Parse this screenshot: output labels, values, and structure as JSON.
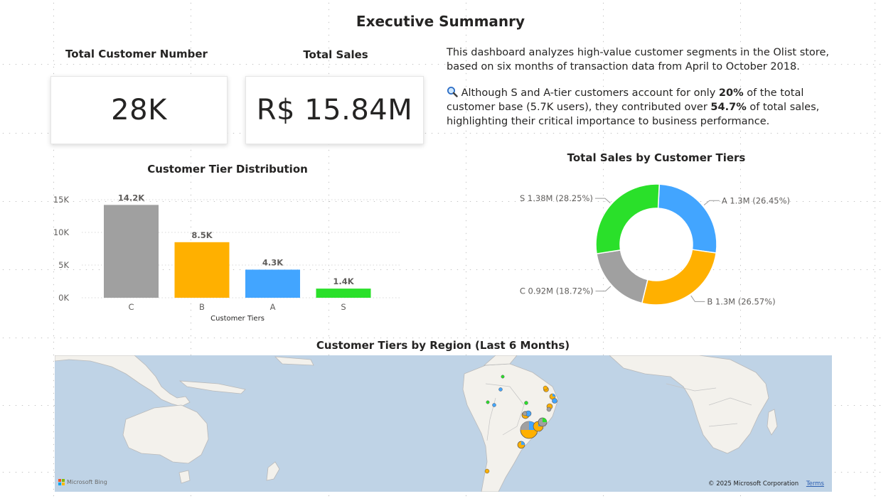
{
  "page_title": "Executive Summanry",
  "kpis": {
    "customers": {
      "label": "Total Customer Number",
      "value": "28K"
    },
    "sales": {
      "label": "Total Sales",
      "value": "R$ 15.84M"
    }
  },
  "description": {
    "p1": "This dashboard analyzes high-value customer segments in the Olist store, based on six months of transaction data from April to October 2018.",
    "p2_icon": "magnifier-icon",
    "p2_pre": "Although S and A-tier customers account for only ",
    "p2_bold1": "20%",
    "p2_mid": " of the total customer base (5.7K users), they contributed over ",
    "p2_bold2": "54.7%",
    "p2_post": " of total sales, highlighting their critical importance to business performance."
  },
  "chart_data": [
    {
      "type": "bar",
      "title": "Customer Tier Distribution",
      "categories": [
        "C",
        "B",
        "A",
        "S"
      ],
      "values": [
        14200,
        8500,
        4300,
        1400
      ],
      "data_labels": [
        "14.2K",
        "8.5K",
        "4.3K",
        "1.4K"
      ],
      "colors": [
        "#a0a0a0",
        "#ffb000",
        "#42a5ff",
        "#2ae02a"
      ],
      "xlabel": "Customer Tiers",
      "ylabel": "",
      "ylim": [
        0,
        15000
      ],
      "yticks": [
        0,
        5000,
        10000,
        15000
      ],
      "ytick_labels": [
        "0K",
        "5K",
        "10K",
        "15K"
      ],
      "grid": true
    },
    {
      "type": "pie",
      "title": "Total Sales by Customer Tiers",
      "donut": true,
      "slices": [
        {
          "label": "A 1.3M (26.45%)",
          "tier": "A",
          "value": 1.3,
          "percent": 26.45,
          "color": "#42a5ff"
        },
        {
          "label": "B 1.3M (26.57%)",
          "tier": "B",
          "value": 1.3,
          "percent": 26.57,
          "color": "#ffb000"
        },
        {
          "label": "C 0.92M (18.72%)",
          "tier": "C",
          "value": 0.92,
          "percent": 18.72,
          "color": "#a0a0a0"
        },
        {
          "label": "S 1.38M (28.25%)",
          "tier": "S",
          "value": 1.38,
          "percent": 28.25,
          "color": "#2ae02a"
        }
      ]
    }
  ],
  "map": {
    "title": "Customer Tiers by Region (Last 6 Months)",
    "provider": "Microsoft Bing",
    "copyright": "© 2025 Microsoft Corporation",
    "terms_link": "Terms"
  }
}
